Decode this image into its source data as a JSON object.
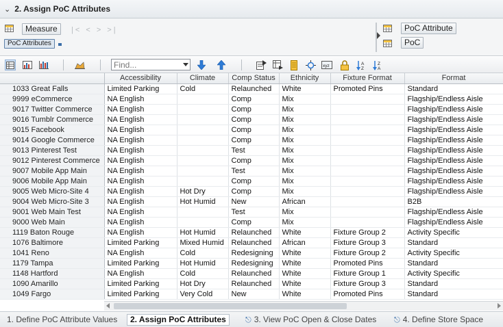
{
  "header": {
    "title": "2. Assign PoC Attributes"
  },
  "pivot": {
    "row_area_label": "Measure",
    "row_field": "PoC Attributes",
    "col_fields": [
      "PoC Attribute",
      "PoC"
    ],
    "nav": "|< < > >|"
  },
  "toolbar": {
    "find_placeholder": "Find..."
  },
  "table": {
    "columns": [
      "",
      "Accessibility",
      "Climate",
      "Comp Status",
      "Ethnicity",
      "Fixture Format",
      "Format"
    ],
    "rows": [
      [
        "1033 Great Falls",
        "Limited Parking",
        "Cold",
        "Relaunched",
        "White",
        "Promoted Pins",
        "Standard"
      ],
      [
        "9999 eCommerce",
        "NA English",
        "",
        "Comp",
        "Mix",
        "",
        "Flagship/Endless Aisle"
      ],
      [
        "9017 Twitter Commerce",
        "NA English",
        "",
        "Comp",
        "Mix",
        "",
        "Flagship/Endless Aisle"
      ],
      [
        "9016 Tumblr Commerce",
        "NA English",
        "",
        "Comp",
        "Mix",
        "",
        "Flagship/Endless Aisle"
      ],
      [
        "9015 Facebook",
        "NA English",
        "",
        "Comp",
        "Mix",
        "",
        "Flagship/Endless Aisle"
      ],
      [
        "9014 Google Commerce",
        "NA English",
        "",
        "Comp",
        "Mix",
        "",
        "Flagship/Endless Aisle"
      ],
      [
        "9013 Pinterest Test",
        "NA English",
        "",
        "Test",
        "Mix",
        "",
        "Flagship/Endless Aisle"
      ],
      [
        "9012 Pinterest Commerce",
        "NA English",
        "",
        "Comp",
        "Mix",
        "",
        "Flagship/Endless Aisle"
      ],
      [
        "9007 Mobile App Main",
        "NA English",
        "",
        "Test",
        "Mix",
        "",
        "Flagship/Endless Aisle"
      ],
      [
        "9006 Mobile App Main",
        "NA English",
        "",
        "Comp",
        "Mix",
        "",
        "Flagship/Endless Aisle"
      ],
      [
        "9005 Web Micro-Site 4",
        "NA English",
        "Hot Dry",
        "Comp",
        "Mix",
        "",
        "Flagship/Endless Aisle"
      ],
      [
        "9004 Web Micro-Site 3",
        "NA English",
        "Hot Humid",
        "New",
        "African",
        "",
        "B2B"
      ],
      [
        "9001 Web Main Test",
        "NA English",
        "",
        "Test",
        "Mix",
        "",
        "Flagship/Endless Aisle"
      ],
      [
        "9000 Web Main",
        "NA English",
        "",
        "Comp",
        "Mix",
        "",
        "Flagship/Endless Aisle"
      ],
      [
        "1119 Baton Rouge",
        "NA English",
        "Hot Humid",
        "Relaunched",
        "White",
        "Fixture Group 2",
        "Activity Specific"
      ],
      [
        "1076 Baltimore",
        "Limited Parking",
        "Mixed Humid",
        "Relaunched",
        "African",
        "Fixture Group 3",
        "Standard"
      ],
      [
        "1041 Reno",
        "NA English",
        "Cold",
        "Redesigning",
        "White",
        "Fixture Group 2",
        "Activity Specific"
      ],
      [
        "1179 Tampa",
        "Limited Parking",
        "Hot Humid",
        "Redesigning",
        "White",
        "Promoted Pins",
        "Standard"
      ],
      [
        "1148 Hartford",
        "NA English",
        "Cold",
        "Relaunched",
        "White",
        "Fixture Group 1",
        "Activity Specific"
      ],
      [
        "1090 Amarillo",
        "Limited Parking",
        "Hot Dry",
        "Relaunched",
        "White",
        "Fixture Group 3",
        "Standard"
      ],
      [
        "1049 Fargo",
        "Limited Parking",
        "Very Cold",
        "New",
        "White",
        "Promoted Pins",
        "Standard"
      ]
    ]
  },
  "tabs": [
    {
      "label": "1. Define PoC Attribute Values",
      "active": false,
      "pinned": false
    },
    {
      "label": "2. Assign PoC Attributes",
      "active": true,
      "pinned": false
    },
    {
      "label": "3. View PoC Open & Close Dates",
      "active": false,
      "pinned": true
    },
    {
      "label": "4. Define Store Space",
      "active": false,
      "pinned": true
    }
  ],
  "icons": [
    "collapse-chevron-icon",
    "grid-icon",
    "table-view-icon",
    "pivot-chart-icon",
    "bar-chart-icon",
    "area-chart-icon",
    "arrow-down-icon",
    "arrow-up-icon",
    "export-icon",
    "import-icon",
    "notes-icon",
    "filter-icon",
    "xyz-icon",
    "lock-icon",
    "sort-az-icon",
    "sort-za-icon",
    "pin-icon"
  ],
  "colors": {
    "accent": "#3a6ea8",
    "active_tab_bg": "#ffffff",
    "header_bg": "#e9ecef"
  }
}
